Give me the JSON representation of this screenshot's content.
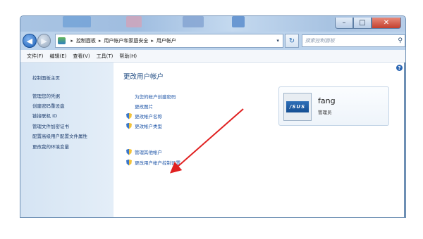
{
  "window": {
    "caption": {
      "minimize": "–",
      "maximize": "□",
      "close": "✕"
    }
  },
  "address_bar": {
    "breadcrumbs": [
      "控制面板",
      "用户帐户和家庭安全",
      "用户帐户"
    ],
    "search_placeholder": "搜索控制面板"
  },
  "menu": [
    "文件(F)",
    "编辑(E)",
    "查看(V)",
    "工具(T)",
    "帮助(H)"
  ],
  "sidebar": {
    "home": "控制面板主页",
    "items": [
      "管理您的凭据",
      "创建密码重设盘",
      "链接联机 ID",
      "管理文件加密证书",
      "配置高级用户配置文件属性",
      "更改我的环境变量"
    ]
  },
  "main": {
    "heading": "更改用户帐户",
    "links": [
      "为您的帐户创建密码",
      "更改图片",
      "更改帐户名称",
      "更改帐户类型"
    ],
    "links2": [
      "管理其他帐户",
      "更改用户帐户控制设置"
    ]
  },
  "user": {
    "name": "fang",
    "role": "管理员",
    "avatar_text": "/SUS"
  },
  "annotation": {
    "arrow_color": "#e02020"
  }
}
